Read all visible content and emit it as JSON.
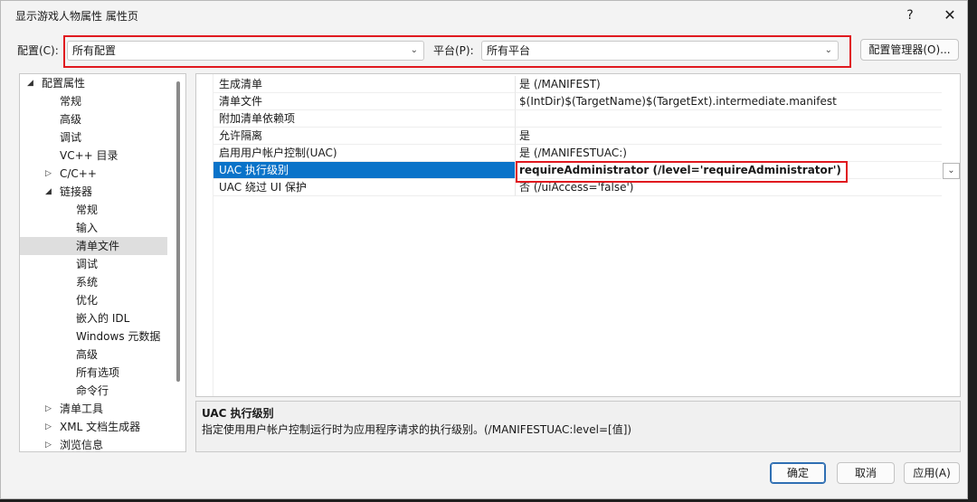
{
  "window": {
    "title": "显示游戏人物属性 属性页",
    "help": "?",
    "close": "✕"
  },
  "config": {
    "label": "配置(C):",
    "value": "所有配置",
    "platform_label": "平台(P):",
    "platform_value": "所有平台",
    "manager_button": "配置管理器(O)..."
  },
  "tree": {
    "items": [
      {
        "label": "配置属性",
        "arrow": "◢"
      },
      {
        "label": "常规"
      },
      {
        "label": "高级"
      },
      {
        "label": "调试"
      },
      {
        "label": "VC++ 目录"
      },
      {
        "label": "C/C++",
        "arrow": "▷"
      },
      {
        "label": "链接器",
        "arrow": "◢"
      },
      {
        "label": "常规"
      },
      {
        "label": "输入"
      },
      {
        "label": "清单文件"
      },
      {
        "label": "调试"
      },
      {
        "label": "系统"
      },
      {
        "label": "优化"
      },
      {
        "label": "嵌入的 IDL"
      },
      {
        "label": "Windows 元数据"
      },
      {
        "label": "高级"
      },
      {
        "label": "所有选项"
      },
      {
        "label": "命令行"
      },
      {
        "label": "清单工具",
        "arrow": "▷"
      },
      {
        "label": "XML 文档生成器",
        "arrow": "▷"
      },
      {
        "label": "浏览信息",
        "arrow": "▷"
      }
    ]
  },
  "grid": {
    "rows": [
      {
        "name": "生成清单",
        "value": "是 (/MANIFEST)"
      },
      {
        "name": "清单文件",
        "value": "$(IntDir)$(TargetName)$(TargetExt).intermediate.manifest"
      },
      {
        "name": "附加清单依赖项",
        "value": ""
      },
      {
        "name": "允许隔离",
        "value": "是"
      },
      {
        "name": "启用用户帐户控制(UAC)",
        "value": "是 (/MANIFESTUAC:)"
      },
      {
        "name": "UAC 执行级别",
        "value": "requireAdministrator (/level='requireAdministrator')"
      },
      {
        "name": "UAC 绕过 UI 保护",
        "value": "否 (/uiAccess='false')"
      }
    ],
    "dropdown_icon": "chevron-down"
  },
  "description": {
    "title": "UAC 执行级别",
    "text": "指定使用用户帐户控制运行时为应用程序请求的执行级别。(/MANIFESTUAC:level=[值])"
  },
  "buttons": {
    "ok": "确定",
    "cancel": "取消",
    "apply": "应用(A)"
  },
  "colors": {
    "selection": "#0a73c9",
    "highlight_box": "#e0191f"
  }
}
